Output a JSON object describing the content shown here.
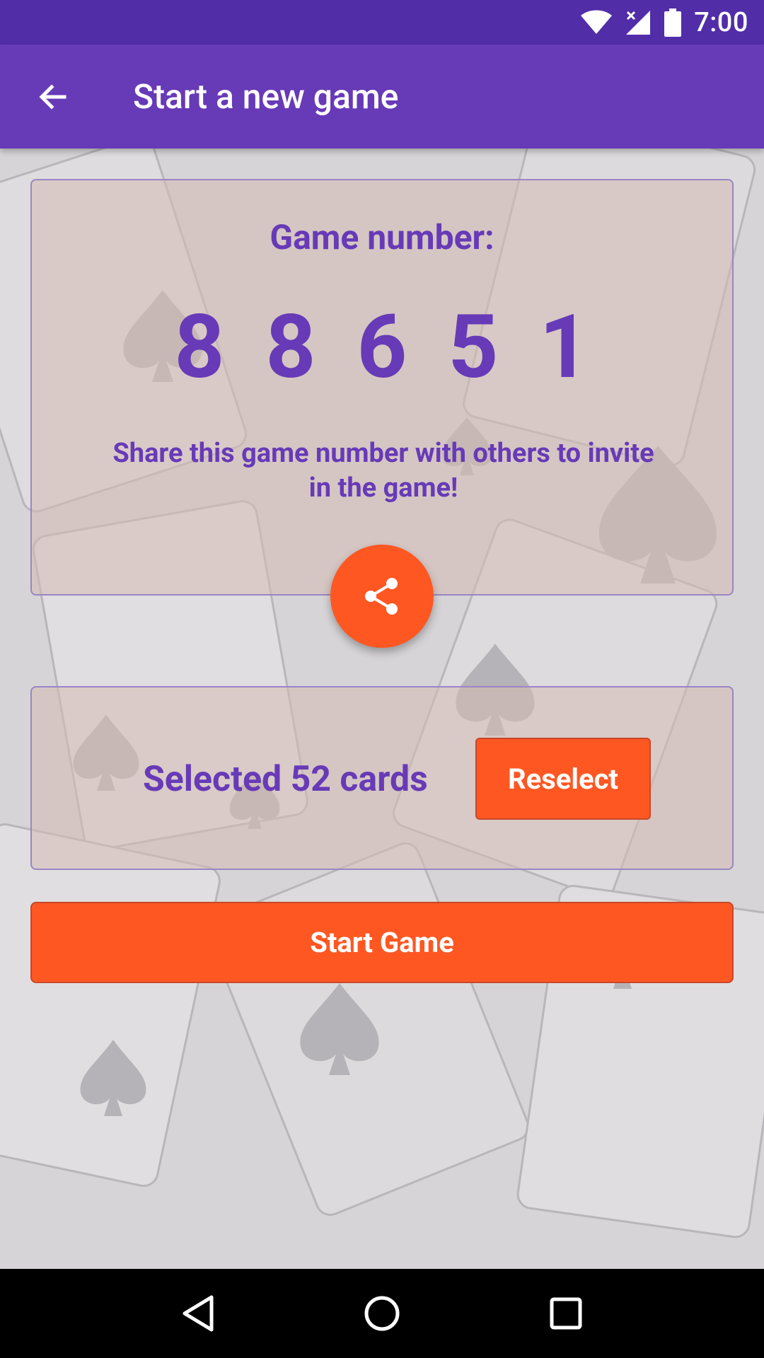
{
  "status_bar": {
    "time": "7:00"
  },
  "app_bar": {
    "title": "Start a new game"
  },
  "game": {
    "label": "Game number:",
    "digits": [
      "8",
      "8",
      "6",
      "5",
      "1"
    ],
    "share_text": "Share this game number with others to invite in the game!"
  },
  "selection": {
    "text": "Selected 52 cards",
    "reselect_label": "Reselect"
  },
  "start_label": "Start Game",
  "colors": {
    "primary": "#673AB7",
    "primary_dark": "#512DA8",
    "accent": "#FF5722"
  }
}
